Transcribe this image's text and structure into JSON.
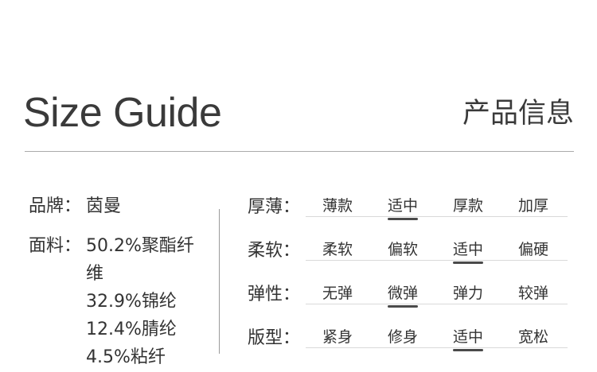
{
  "header": {
    "title_en": "Size Guide",
    "title_cn": "产品信息"
  },
  "info": {
    "brand": {
      "label": "品牌：",
      "value": "茵曼"
    },
    "fabric": {
      "label": "面料：",
      "lines": [
        "50.2%聚酯纤",
        "维",
        "32.9%锦纶",
        "12.4%腈纶",
        "4.5%粘纤"
      ]
    }
  },
  "attributes": [
    {
      "label": "厚薄：",
      "options": [
        "薄款",
        "适中",
        "厚款",
        "加厚"
      ],
      "selected": 1
    },
    {
      "label": "柔软：",
      "options": [
        "柔软",
        "偏软",
        "适中",
        "偏硬"
      ],
      "selected": 2
    },
    {
      "label": "弹性：",
      "options": [
        "无弹",
        "微弹",
        "弹力",
        "较弹"
      ],
      "selected": 1
    },
    {
      "label": "版型：",
      "options": [
        "紧身",
        "修身",
        "适中",
        "宽松"
      ],
      "selected": 2
    }
  ],
  "colors": {
    "text": "#333333",
    "rule": "#aaaaaa",
    "selected_underline": "#4a4a4a"
  }
}
